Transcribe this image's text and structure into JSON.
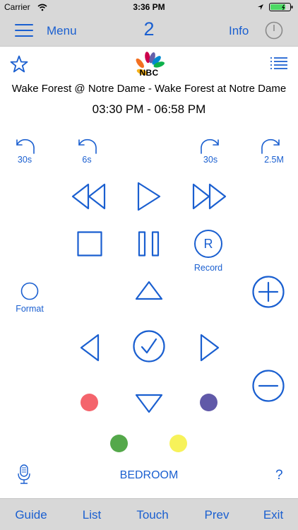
{
  "status_bar": {
    "carrier": "Carrier",
    "time": "3:36 PM"
  },
  "nav": {
    "menu_label": "Menu",
    "channel_number": "2",
    "info_label": "Info"
  },
  "program": {
    "network_logo_text": "NBC",
    "title": "Wake Forest @ Notre Dame - Wake Forest at Notre Dame",
    "time_range": "03:30 PM - 06:58 PM"
  },
  "controls": {
    "skip_back_30": "30s",
    "skip_back_6": "6s",
    "skip_fwd_30": "30s",
    "skip_fwd_2m": "2.5M",
    "record_letter": "R",
    "record_label": "Record",
    "format_label": "Format"
  },
  "colors": {
    "accent": "#1a5fd0",
    "red": "#f4646c",
    "purple": "#6059a8",
    "green": "#54a84a",
    "yellow": "#f7f25a"
  },
  "footer": {
    "room_label": "BEDROOM",
    "help_label": "?"
  },
  "tabs": [
    "Guide",
    "List",
    "Touch",
    "Prev",
    "Exit"
  ]
}
